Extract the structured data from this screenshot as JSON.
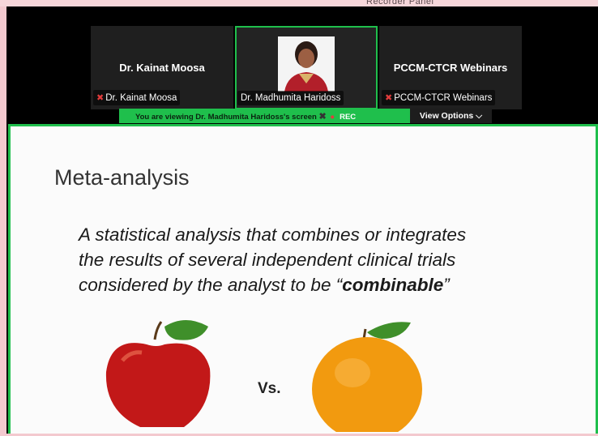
{
  "top_partial_text": "Recorder Panel",
  "tiles": [
    {
      "title": "Dr. Kainat Moosa",
      "label": "Dr. Kainat Moosa",
      "muted": true
    },
    {
      "title": "",
      "label": "Dr. Madhumita Haridoss",
      "muted": false,
      "active": true
    },
    {
      "title": "PCCM-CTCR Webinars",
      "label": "PCCM-CTCR Webinars",
      "muted": true
    }
  ],
  "banner": {
    "viewing_text": "You are viewing  Dr. Madhumita Haridoss's screen",
    "rec_label": "REC",
    "view_options_label": "View Options"
  },
  "slide": {
    "title": "Meta-analysis",
    "body_line1": "A statistical analysis that combines or integrates",
    "body_line2": "the results of several independent clinical trials",
    "body_line3_pre": "considered by the analyst to be ",
    "body_quote_open": "“",
    "body_bold": "combinable",
    "body_quote_close": "”",
    "vs_label": "Vs."
  },
  "icons": [
    "mute-icon",
    "chevron-down-icon",
    "mute-icon"
  ],
  "colors": {
    "accent_green": "#1fbf4c",
    "mute_red": "#e23c3c"
  }
}
